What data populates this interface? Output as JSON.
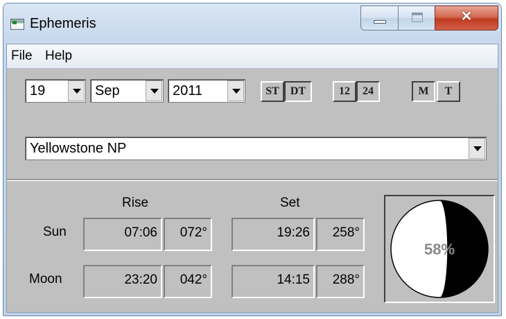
{
  "window": {
    "title": "Ephemeris"
  },
  "menu": {
    "file": "File",
    "help": "Help"
  },
  "date": {
    "day": "19",
    "month": "Sep",
    "year": "2011"
  },
  "toggles": {
    "st": "ST",
    "dt": "DT",
    "h12": "12",
    "h24": "24",
    "m": "M",
    "t": "T"
  },
  "location": {
    "value": "Yellowstone NP"
  },
  "table": {
    "rise_header": "Rise",
    "set_header": "Set",
    "rows": [
      {
        "label": "Sun",
        "rise_time": "07:06",
        "rise_az": "072°",
        "set_time": "19:26",
        "set_az": "258°"
      },
      {
        "label": "Moon",
        "rise_time": "23:20",
        "rise_az": "042°",
        "set_time": "14:15",
        "set_az": "288°"
      }
    ]
  },
  "moon_phase": {
    "illumination_label": "58%",
    "illumination": 0.58
  },
  "colors": {
    "face": "#c0c0c0",
    "close_button": "#c0391f"
  }
}
